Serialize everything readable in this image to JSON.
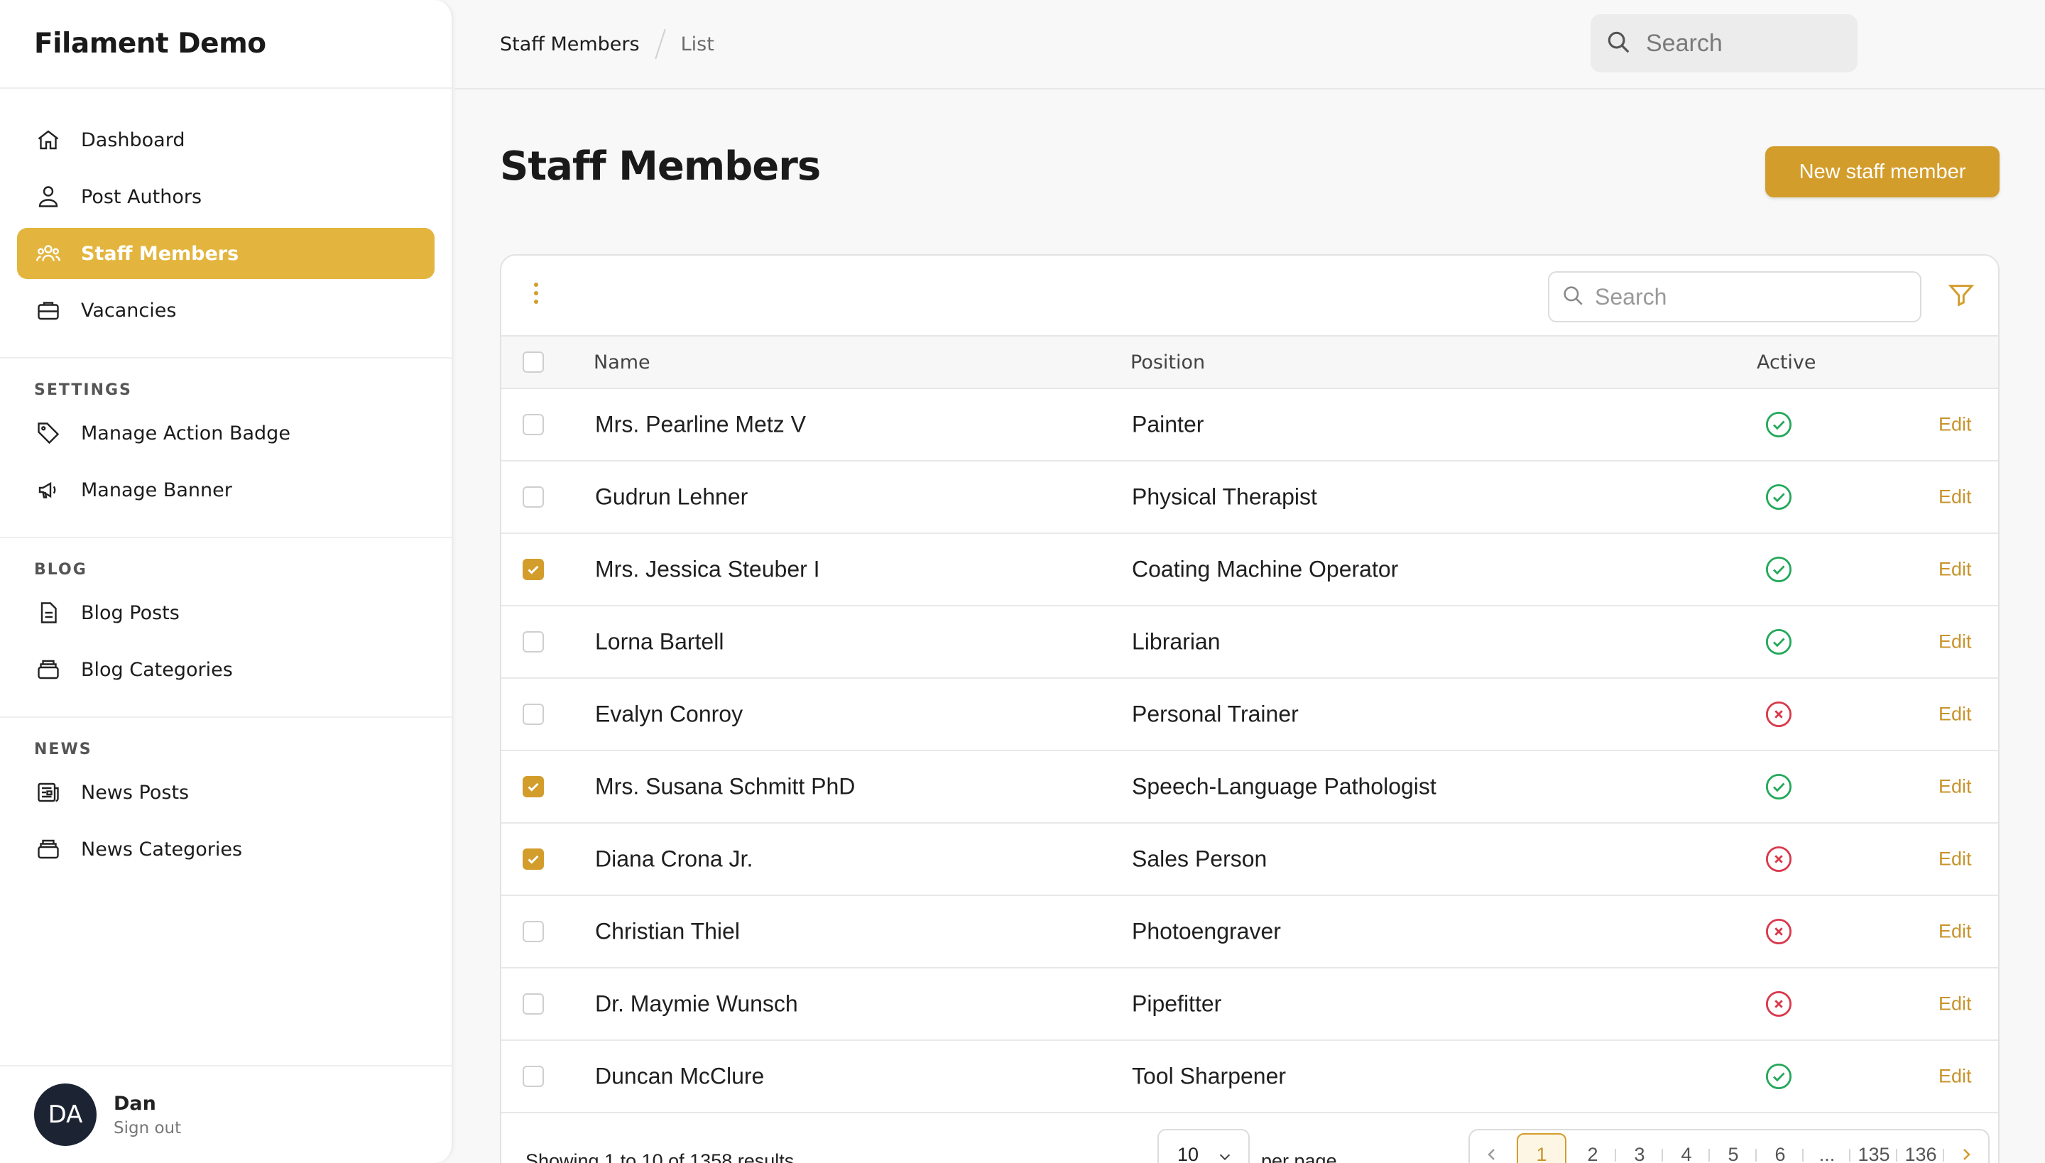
{
  "app": {
    "title": "Filament Demo"
  },
  "sidebar": {
    "main": [
      {
        "label": "Dashboard",
        "icon": "home-icon",
        "active": false
      },
      {
        "label": "Post Authors",
        "icon": "users-icon",
        "active": false
      },
      {
        "label": "Staff Members",
        "icon": "user-group-icon",
        "active": true
      },
      {
        "label": "Vacancies",
        "icon": "briefcase-icon",
        "active": false
      }
    ],
    "settings": {
      "title": "SETTINGS",
      "items": [
        {
          "label": "Manage Action Badge",
          "icon": "tag-icon"
        },
        {
          "label": "Manage Banner",
          "icon": "megaphone-icon"
        }
      ]
    },
    "blog": {
      "title": "BLOG",
      "items": [
        {
          "label": "Blog Posts",
          "icon": "document-icon"
        },
        {
          "label": "Blog Categories",
          "icon": "rectangle-stack-icon"
        }
      ]
    },
    "news": {
      "title": "NEWS",
      "items": [
        {
          "label": "News Posts",
          "icon": "newspaper-icon"
        },
        {
          "label": "News Categories",
          "icon": "rectangle-stack-icon"
        }
      ]
    }
  },
  "user": {
    "initials": "DA",
    "name": "Dan",
    "signout": "Sign out"
  },
  "topbar": {
    "breadcrumb": [
      "Staff Members",
      "List"
    ],
    "search_placeholder": "Search"
  },
  "page": {
    "title": "Staff Members",
    "new_button": "New staff member"
  },
  "table": {
    "search_placeholder": "Search",
    "columns": [
      "Name",
      "Position",
      "Active"
    ],
    "edit_label": "Edit",
    "rows": [
      {
        "name": "Mrs. Pearline Metz V",
        "position": "Painter",
        "active": true,
        "selected": false
      },
      {
        "name": "Gudrun Lehner",
        "position": "Physical Therapist",
        "active": true,
        "selected": false
      },
      {
        "name": "Mrs. Jessica Steuber I",
        "position": "Coating Machine Operator",
        "active": true,
        "selected": true
      },
      {
        "name": "Lorna Bartell",
        "position": "Librarian",
        "active": true,
        "selected": false
      },
      {
        "name": "Evalyn Conroy",
        "position": "Personal Trainer",
        "active": false,
        "selected": false
      },
      {
        "name": "Mrs. Susana Schmitt PhD",
        "position": "Speech-Language Pathologist",
        "active": true,
        "selected": true
      },
      {
        "name": "Diana Crona Jr.",
        "position": "Sales Person",
        "active": false,
        "selected": true
      },
      {
        "name": "Christian Thiel",
        "position": "Photoengraver",
        "active": false,
        "selected": false
      },
      {
        "name": "Dr. Maymie Wunsch",
        "position": "Pipefitter",
        "active": false,
        "selected": false
      },
      {
        "name": "Duncan McClure",
        "position": "Tool Sharpener",
        "active": true,
        "selected": false
      }
    ],
    "footer": {
      "showing": "Showing 1 to 10 of 1358 results",
      "per_page_value": "10",
      "per_page_label": "per page",
      "pages": [
        "1",
        "2",
        "3",
        "4",
        "5",
        "6",
        "...",
        "135",
        "136"
      ],
      "current_page": "1"
    }
  },
  "colors": {
    "accent": "#e3b53e",
    "accent_dark": "#d39d2c",
    "active_green": "#22a85a",
    "inactive_red": "#d9384a"
  }
}
